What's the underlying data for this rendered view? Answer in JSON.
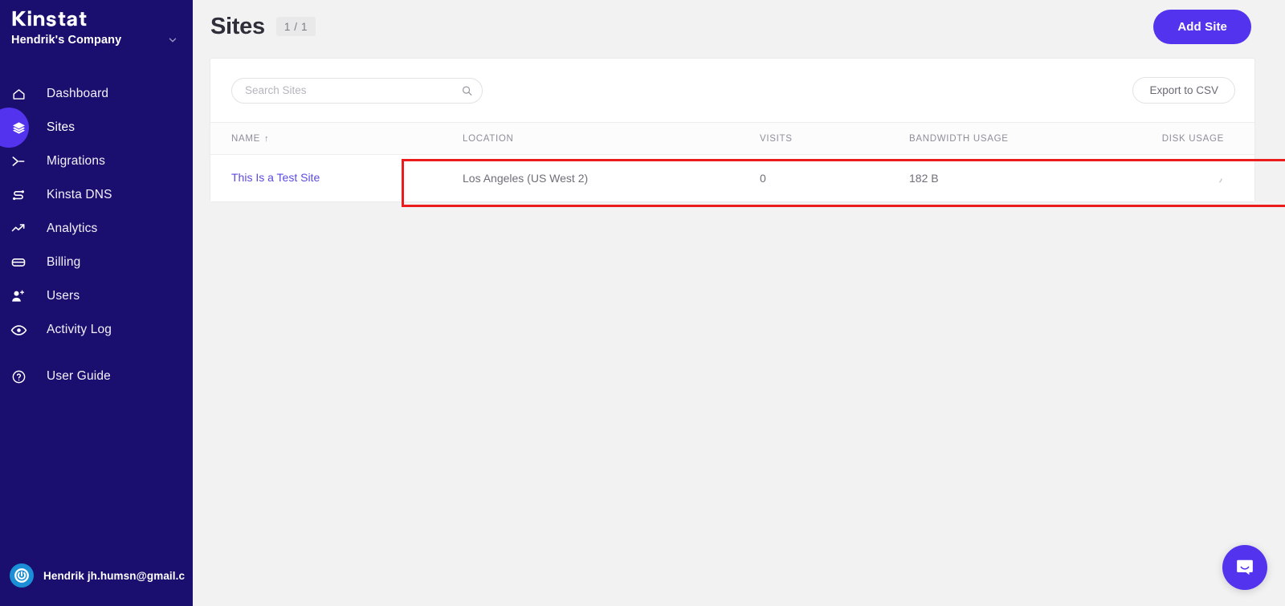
{
  "sidebar": {
    "logo_text": "Kinsta",
    "company_name": "Hendrik's Company",
    "items": [
      {
        "label": "Dashboard",
        "icon": "home-icon"
      },
      {
        "label": "Sites",
        "icon": "layers-icon"
      },
      {
        "label": "Migrations",
        "icon": "migrations-icon"
      },
      {
        "label": "Kinsta DNS",
        "icon": "dns-icon"
      },
      {
        "label": "Analytics",
        "icon": "analytics-icon"
      },
      {
        "label": "Billing",
        "icon": "billing-card-icon"
      },
      {
        "label": "Users",
        "icon": "user-plus-icon"
      },
      {
        "label": "Activity Log",
        "icon": "eye-icon"
      },
      {
        "label": "User Guide",
        "icon": "question-circle-icon"
      }
    ],
    "active_item": "Sites",
    "user_name": "Hendrik jh.humsn@gmail.c"
  },
  "header": {
    "title": "Sites",
    "count_badge": "1 / 1",
    "add_site_label": "Add Site"
  },
  "toolbar": {
    "search_placeholder": "Search Sites",
    "search_value": "",
    "export_label": "Export to CSV"
  },
  "table": {
    "columns": [
      {
        "label": "NAME",
        "sort": "↑"
      },
      {
        "label": "LOCATION",
        "sort": ""
      },
      {
        "label": "VISITS",
        "sort": ""
      },
      {
        "label": "BANDWIDTH USAGE",
        "sort": ""
      },
      {
        "label": "DISK USAGE",
        "sort": ""
      }
    ],
    "rows": [
      {
        "name": "This Is a Test Site",
        "location": "Los Angeles (US West 2)",
        "visits": "0",
        "bandwidth": "182 B",
        "disk": ""
      }
    ]
  },
  "colors": {
    "sidebar_bg": "#1a0f6e",
    "accent": "#5333ED",
    "page_bg": "#f2f2f2",
    "annotation": "#ED1C1C",
    "link": "#5b4ae0"
  }
}
